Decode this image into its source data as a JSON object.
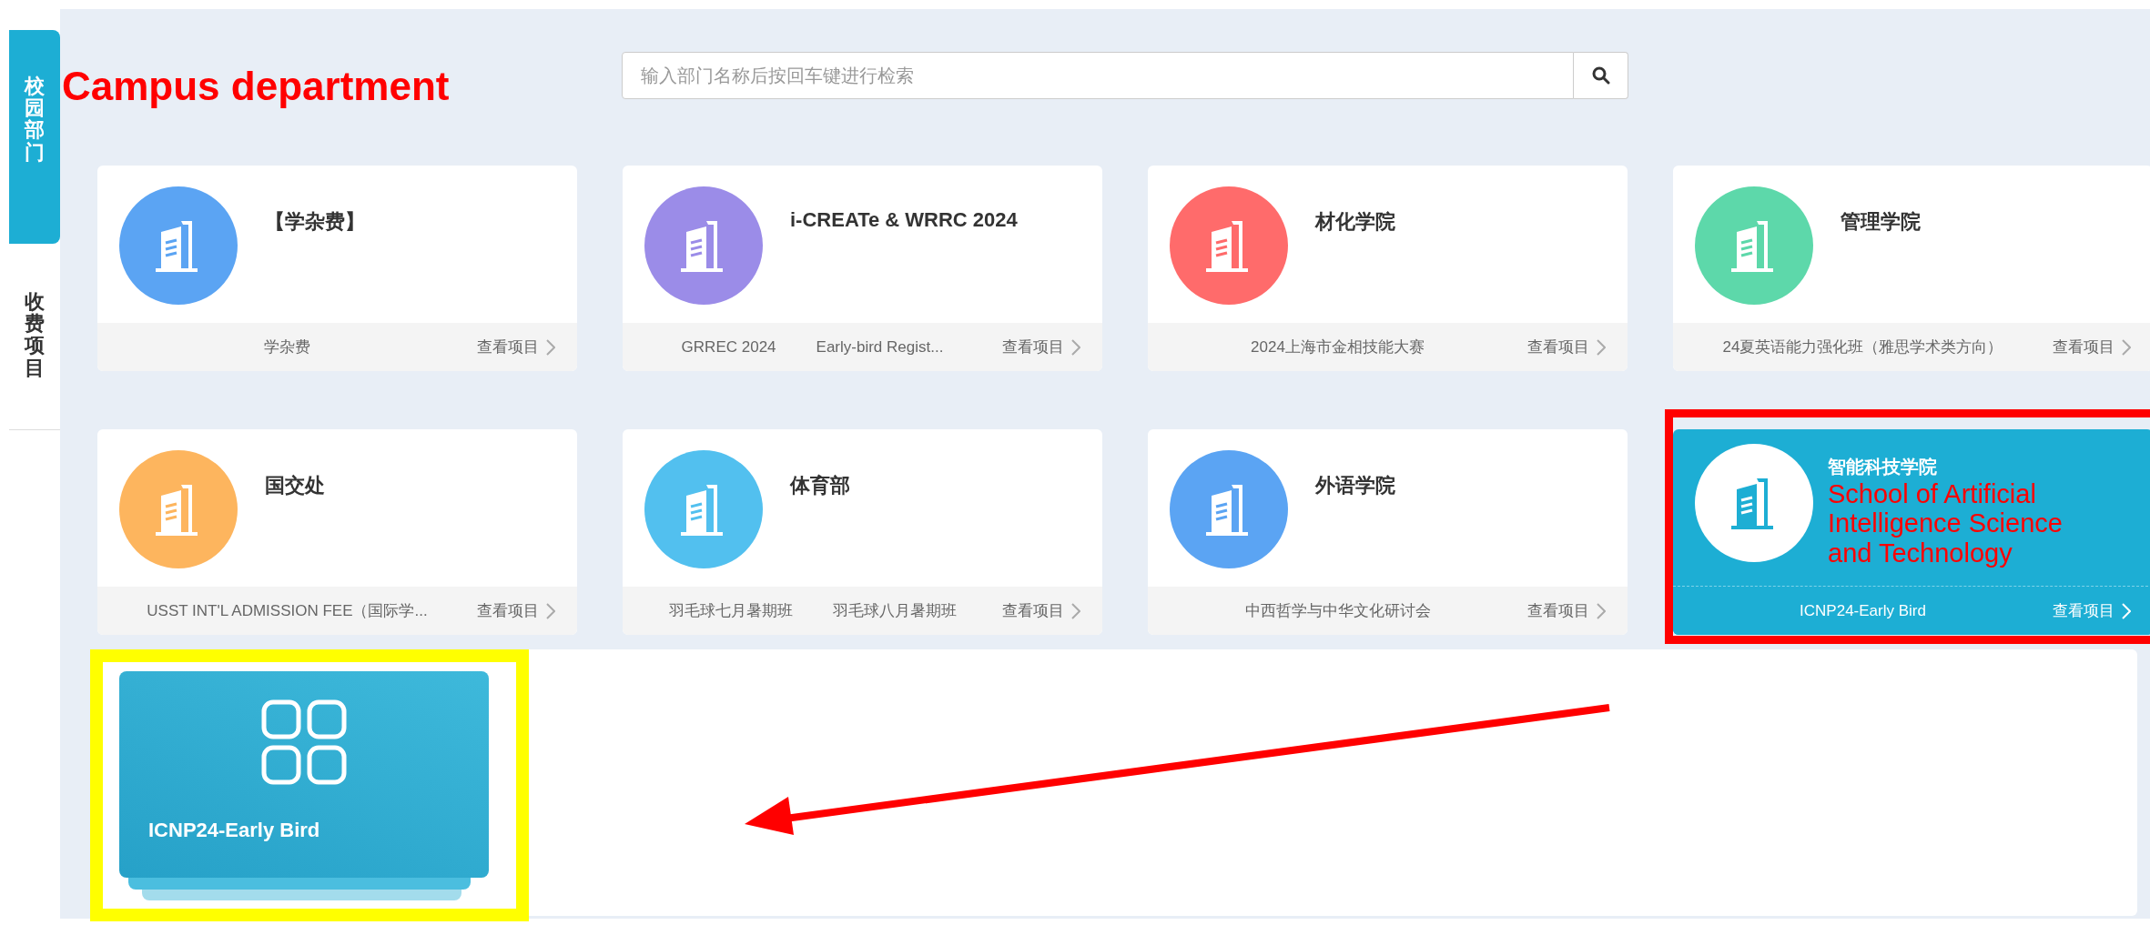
{
  "sidebar": {
    "tabs": [
      {
        "label": "校园部门",
        "selected": true
      },
      {
        "label": "收费项目",
        "selected": false
      }
    ]
  },
  "annotation": {
    "label": "Campus department"
  },
  "search": {
    "placeholder": "输入部门名称后按回车键进行检索"
  },
  "departments": [
    {
      "name": "【学杂费】",
      "color": "#5ba4f3",
      "items": [
        "学杂费"
      ],
      "link": "查看项目",
      "selected": false,
      "boxed": false
    },
    {
      "name": "i-CREATe & WRRC 2024",
      "color": "#9b8ce8",
      "items": [
        "GRREC 2024",
        "Early-bird Regist..."
      ],
      "link": "查看项目",
      "selected": false,
      "boxed": false
    },
    {
      "name": "材化学院",
      "color": "#ff6b6b",
      "items": [
        "2024上海市金相技能大赛"
      ],
      "link": "查看项目",
      "selected": false,
      "boxed": false
    },
    {
      "name": "管理学院",
      "color": "#5dd8aa",
      "items": [
        "24夏英语能力强化班（雅思学术类方向）"
      ],
      "link": "查看项目",
      "selected": false,
      "boxed": false
    },
    {
      "name": "国交处",
      "color": "#fdb55e",
      "items": [
        "USST INT'L ADMISSION FEE（国际学..."
      ],
      "link": "查看项目",
      "selected": false,
      "boxed": false
    },
    {
      "name": "体育部",
      "color": "#52c0ef",
      "items": [
        "羽毛球七月暑期班",
        "羽毛球八月暑期班"
      ],
      "link": "查看项目",
      "selected": false,
      "boxed": false
    },
    {
      "name": "外语学院",
      "color": "#5ba4f3",
      "items": [
        "中西哲学与中华文化研讨会"
      ],
      "link": "查看项目",
      "selected": false,
      "boxed": false
    },
    {
      "name": "智能科技学院",
      "callout": "School of Artificial Intelligence Science and Technology",
      "color": "#1daed4",
      "items": [
        "ICNP24-Early Bird"
      ],
      "link": "查看项目",
      "selected": true,
      "boxed": true
    }
  ],
  "projects": [
    {
      "title": "ICNP24-Early Bird",
      "highlighted": true
    }
  ]
}
